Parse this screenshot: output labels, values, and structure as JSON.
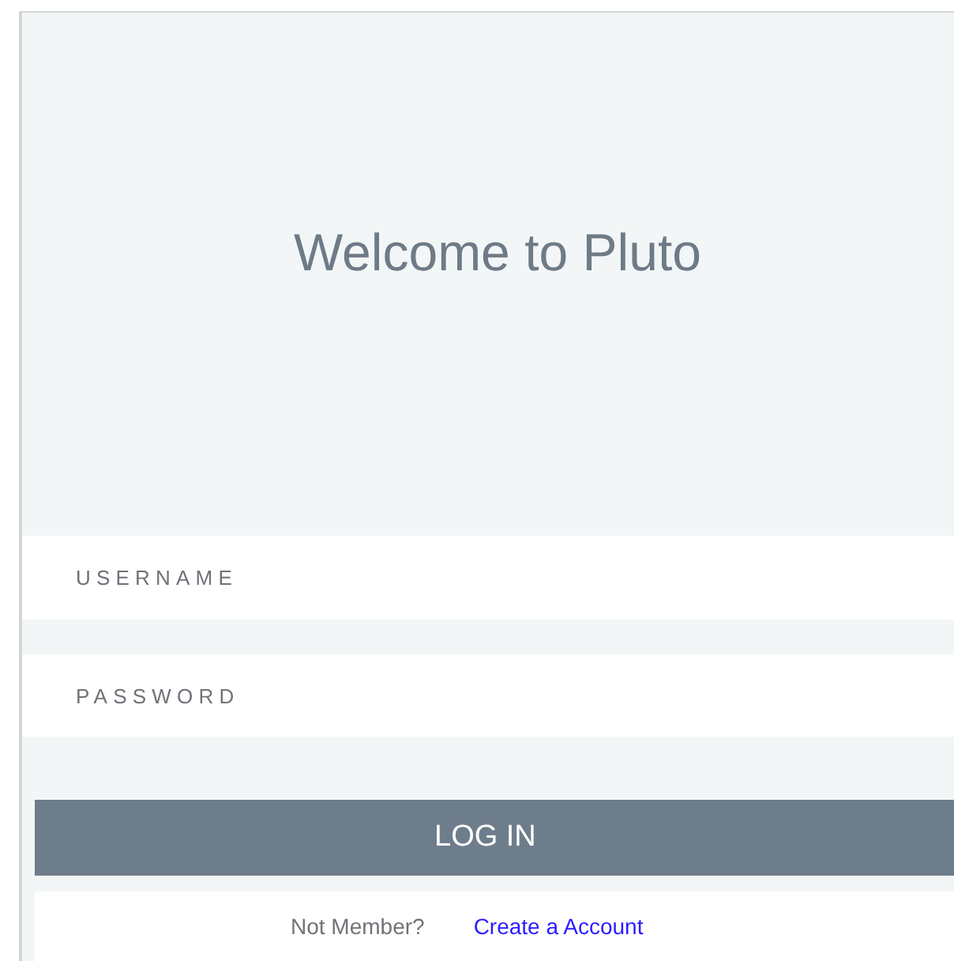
{
  "title": "Welcome to Pluto",
  "fields": [
    {
      "placeholder": "USERNAME"
    },
    {
      "placeholder": "PASSWORD"
    }
  ],
  "login_button": "LOG IN",
  "footer": {
    "prompt": "Not Member?",
    "link": "Create a Account"
  }
}
